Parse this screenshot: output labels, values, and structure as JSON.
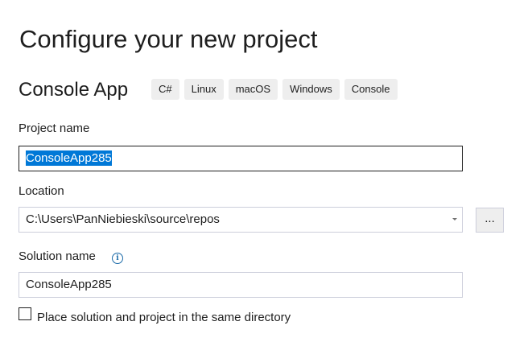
{
  "page": {
    "title": "Configure your new project"
  },
  "template": {
    "name": "Console App",
    "tags": [
      "C#",
      "Linux",
      "macOS",
      "Windows",
      "Console"
    ]
  },
  "project_name": {
    "label": "Project name",
    "value": "ConsoleApp285",
    "selected": true
  },
  "location": {
    "label": "Location",
    "value": "C:\\Users\\PanNiebieski\\source\\repos",
    "browse_label": "..."
  },
  "solution_name": {
    "label": "Solution name",
    "value": "ConsoleApp285",
    "info_icon": "info-icon"
  },
  "same_directory": {
    "label": "Place solution and project in the same directory",
    "checked": false
  },
  "colors": {
    "selection": "#0078d7",
    "info": "#1a6aa8",
    "tag_background": "#eeeeee"
  }
}
